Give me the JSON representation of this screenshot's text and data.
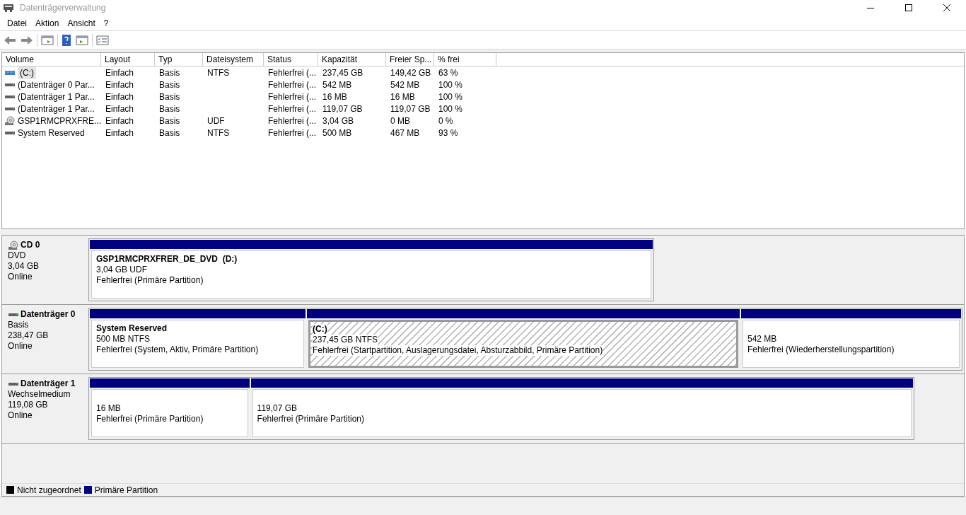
{
  "window": {
    "title": "Datenträgerverwaltung"
  },
  "menu": [
    "Datei",
    "Aktion",
    "Ansicht",
    "?"
  ],
  "table": {
    "columns": [
      "Volume",
      "Layout",
      "Typ",
      "Dateisystem",
      "Status",
      "Kapazität",
      "Freier Sp...",
      "% frei"
    ],
    "rows": [
      {
        "kind": "system",
        "selected": true,
        "cells": [
          "(C:)",
          "Einfach",
          "Basis",
          "NTFS",
          "Fehlerfrei (...",
          "237,45 GB",
          "149,42 GB",
          "63 %"
        ]
      },
      {
        "kind": "drive",
        "selected": false,
        "cells": [
          "(Datenträger 0 Par...",
          "Einfach",
          "Basis",
          "",
          "Fehlerfrei (...",
          "542 MB",
          "542 MB",
          "100 %"
        ]
      },
      {
        "kind": "drive",
        "selected": false,
        "cells": [
          "(Datenträger 1 Par...",
          "Einfach",
          "Basis",
          "",
          "Fehlerfrei (...",
          "16 MB",
          "16 MB",
          "100 %"
        ]
      },
      {
        "kind": "drive",
        "selected": false,
        "cells": [
          "(Datenträger 1 Par...",
          "Einfach",
          "Basis",
          "",
          "Fehlerfrei (...",
          "119,07 GB",
          "119,07 GB",
          "100 %"
        ]
      },
      {
        "kind": "cd",
        "selected": false,
        "cells": [
          "GSP1RMCPRXFRE...",
          "Einfach",
          "Basis",
          "UDF",
          "Fehlerfrei (...",
          "3,04 GB",
          "0 MB",
          "0 %"
        ]
      },
      {
        "kind": "drive",
        "selected": false,
        "cells": [
          "System Reserved",
          "Einfach",
          "Basis",
          "NTFS",
          "Fehlerfrei (...",
          "500 MB",
          "467 MB",
          "93 %"
        ]
      }
    ]
  },
  "disks": [
    {
      "kind": "cd",
      "name": "CD 0",
      "type": "DVD",
      "size": "3,04 GB",
      "state": "Online",
      "partitions": [
        {
          "selected": false,
          "title": "GSP1RMCPRXFRER_DE_DVD  (D:)",
          "size": "3,04 GB UDF",
          "status": "Fehlerfrei (Primäre Partition)"
        }
      ]
    },
    {
      "kind": "drive",
      "name": "Datenträger 0",
      "type": "Basis",
      "size": "238,47 GB",
      "state": "Online",
      "partitions": [
        {
          "selected": false,
          "title": "System Reserved",
          "size": "500 MB NTFS",
          "status": "Fehlerfrei (System, Aktiv, Primäre Partition)"
        },
        {
          "selected": true,
          "title": "(C:)",
          "size": "237,45 GB NTFS",
          "status": "Fehlerfrei (Startpartition, Auslagerungsdatei, Absturzabbild, Primäre Partition)"
        },
        {
          "selected": false,
          "size": "542 MB",
          "status": "Fehlerfrei (Wiederherstellungspartition)"
        }
      ]
    },
    {
      "kind": "drive",
      "name": "Datenträger 1",
      "type": "Wechselmedium",
      "size": "119,08 GB",
      "state": "Online",
      "partitions": [
        {
          "selected": false,
          "size": "16 MB",
          "status": "Fehlerfrei (Primäre Partition)"
        },
        {
          "selected": false,
          "size": "119,07 GB",
          "status": "Fehlerfrei (Primäre Partition)"
        }
      ]
    }
  ],
  "legend": [
    {
      "label": "Nicht zugeordnet",
      "color": "#000000"
    },
    {
      "label": "Primäre Partition",
      "color": "#000080"
    }
  ]
}
